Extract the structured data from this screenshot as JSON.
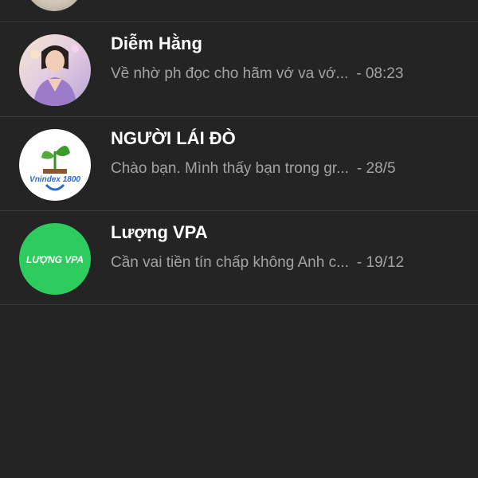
{
  "conversations": [
    {
      "name": "Diễm Hằng",
      "preview": "Về nhờ ph đọc cho hãm vớ va vớ...",
      "time": "- 08:23"
    },
    {
      "name": "NGƯỜI LÁI ĐÒ",
      "preview": "Chào bạn. Mình thấy bạn trong gr...",
      "time": "- 28/5",
      "avatar_text": "Vnindex 1800"
    },
    {
      "name": "Lượng VPA",
      "preview": "Cần vai tiền tín chấp không Anh c...",
      "time": "- 19/12",
      "avatar_text": "LƯỢNG VPA",
      "avatar_color": "#2ecc5e"
    }
  ],
  "colors": {
    "background": "#242424",
    "divider": "#3a3a3a",
    "name": "#ffffff",
    "preview": "#a3a3a3"
  }
}
